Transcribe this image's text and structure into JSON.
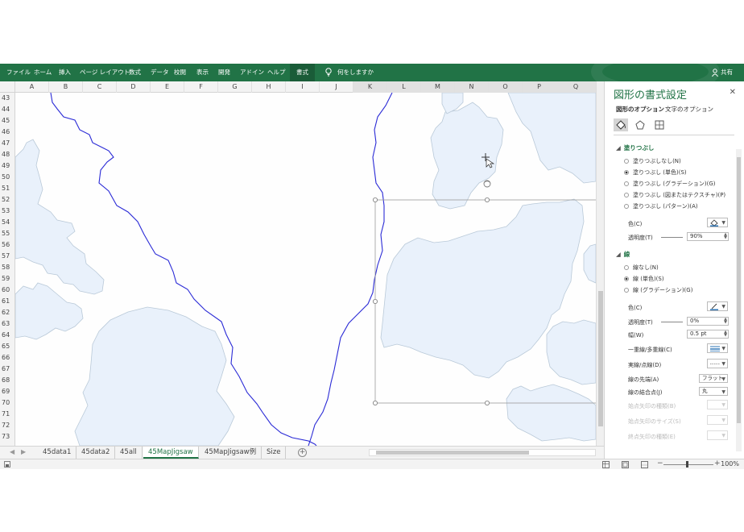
{
  "ribbon": {
    "tabs": [
      {
        "label": "ファイル",
        "active": false
      },
      {
        "label": "ホーム",
        "active": false
      },
      {
        "label": "挿入",
        "active": false
      },
      {
        "label": "ページ レイアウト",
        "active": false
      },
      {
        "label": "数式",
        "active": false
      },
      {
        "label": "データ",
        "active": false
      },
      {
        "label": "校閲",
        "active": false
      },
      {
        "label": "表示",
        "active": false
      },
      {
        "label": "開発",
        "active": false
      },
      {
        "label": "アドイン",
        "active": false
      },
      {
        "label": "ヘルプ",
        "active": false
      },
      {
        "label": "書式",
        "active": true
      }
    ],
    "tell_me": "何をしますか",
    "share": "共有",
    "accent_color": "#217346"
  },
  "columns": [
    "A",
    "B",
    "C",
    "D",
    "E",
    "F",
    "G",
    "H",
    "I",
    "J",
    "K",
    "L",
    "M",
    "N",
    "O",
    "P",
    "Q"
  ],
  "rows": [
    "43",
    "44",
    "45",
    "46",
    "47",
    "48",
    "49",
    "50",
    "51",
    "52",
    "53",
    "54",
    "55",
    "56",
    "57",
    "58",
    "59",
    "60",
    "61",
    "62",
    "63",
    "64",
    "65",
    "66",
    "67",
    "68",
    "69",
    "70",
    "71",
    "72",
    "73"
  ],
  "sheets": [
    {
      "label": "45data1",
      "active": false
    },
    {
      "label": "45data2",
      "active": false
    },
    {
      "label": "45all",
      "active": false
    },
    {
      "label": "45MapJigsaw",
      "active": true
    },
    {
      "label": "45MapJigsaw例",
      "active": false
    },
    {
      "label": "Size",
      "active": false
    }
  ],
  "status": {
    "zoom": "100%"
  },
  "pane": {
    "title": "図形の書式設定",
    "tab_shape": "図形のオプション",
    "tab_text": "文字のオプション",
    "fill": {
      "header": "塗りつぶし",
      "options": [
        {
          "label": "塗りつぶしなし(N)",
          "selected": false
        },
        {
          "label": "塗りつぶし (単色)(S)",
          "selected": true
        },
        {
          "label": "塗りつぶし (グラデーション)(G)",
          "selected": false
        },
        {
          "label": "塗りつぶし (図またはテクスチャ)(P)",
          "selected": false
        },
        {
          "label": "塗りつぶし (パターン)(A)",
          "selected": false
        }
      ],
      "color_label": "色(C)",
      "transparency_label": "透明度(T)",
      "transparency_value": "90%"
    },
    "line": {
      "header": "線",
      "options": [
        {
          "label": "線なし(N)",
          "selected": false
        },
        {
          "label": "線 (単色)(S)",
          "selected": true
        },
        {
          "label": "線 (グラデーション)(G)",
          "selected": false
        }
      ],
      "color_label": "色(C)",
      "transparency_label": "透明度(T)",
      "transparency_value": "0%",
      "width_label": "幅(W)",
      "width_value": "0.5 pt",
      "compound_label": "一重線/多重線(C)",
      "dash_label": "実線/点線(D)",
      "cap_label": "線の先端(A)",
      "cap_value": "フラット",
      "join_label": "線の結合点(J)",
      "join_value": "丸",
      "begin_arrow_type": "始点矢印の種類(B)",
      "begin_arrow_size": "始点矢印のサイズ(S)",
      "end_arrow_type": "終点矢印の種類(E)"
    }
  },
  "map": {
    "fill_color": "#e9f1fb",
    "outline_color": "#b9c9d8",
    "border_line_color": "#2b2bd6"
  }
}
